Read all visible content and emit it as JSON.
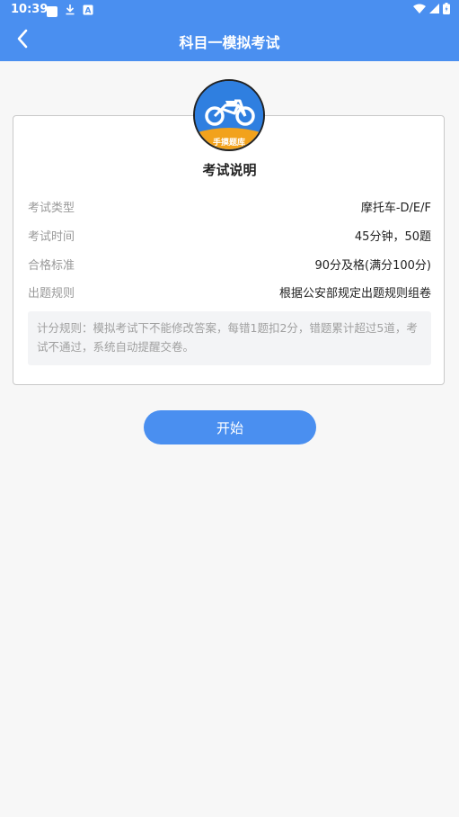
{
  "status_bar": {
    "time": "10:39",
    "icons": [
      "notification-icon",
      "download-icon",
      "a-badge-icon",
      "wifi-icon",
      "signal-icon",
      "battery-icon"
    ]
  },
  "header": {
    "title": "科目一模拟考试",
    "background": "#4a8ff0"
  },
  "exam_card": {
    "logo_text": "手摸题库",
    "title": "考试说明",
    "rows": [
      {
        "label": "考试类型",
        "value": "摩托车-D/E/F"
      },
      {
        "label": "考试时间",
        "value": "45分钟，50题"
      },
      {
        "label": "合格标准",
        "value": "90分及格(满分100分)"
      },
      {
        "label": "出题规则",
        "value": "根据公安部规定出题规则组卷"
      }
    ],
    "scoring_rules": "计分规则：模拟考试下不能修改答案，每错1题扣2分，错题累计超过5道，考试不通过，系统自动提醒交卷。"
  },
  "actions": {
    "start_label": "开始",
    "accent": "#4a8ff0"
  }
}
